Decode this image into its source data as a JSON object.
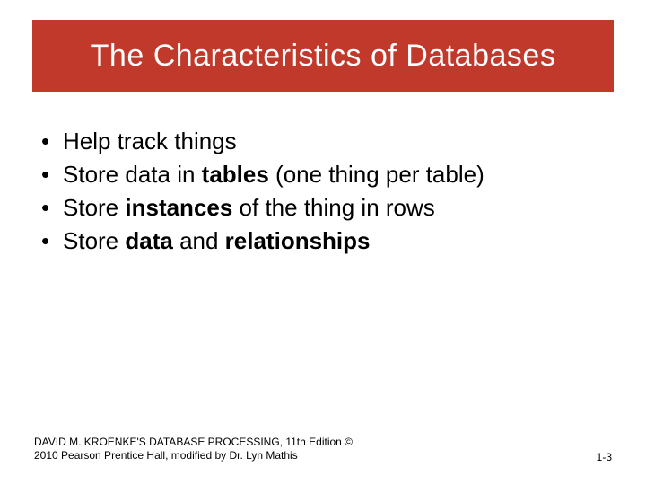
{
  "title": "The Characteristics of Databases",
  "bullet_marker": "•",
  "bullets": {
    "b0": {
      "pre": "Help track things"
    },
    "b1": {
      "pre": "Store data in ",
      "bold1": "tables",
      "post1": " (one thing per table)"
    },
    "b2": {
      "pre": "Store ",
      "bold1": "instances",
      "post1": " of the thing in rows"
    },
    "b3": {
      "pre": "Store ",
      "bold1": "data",
      "mid": " and ",
      "bold2": "relationships"
    }
  },
  "footer": {
    "left_line1": "DAVID M. KROENKE'S DATABASE PROCESSING, 11th Edition  ©",
    "left_line2": "2010 Pearson Prentice Hall,  modified by Dr. Lyn Mathis",
    "page": "1-3"
  },
  "colors": {
    "title_band": "#c0392b",
    "title_text": "#ffffff",
    "body_text": "#000000"
  }
}
